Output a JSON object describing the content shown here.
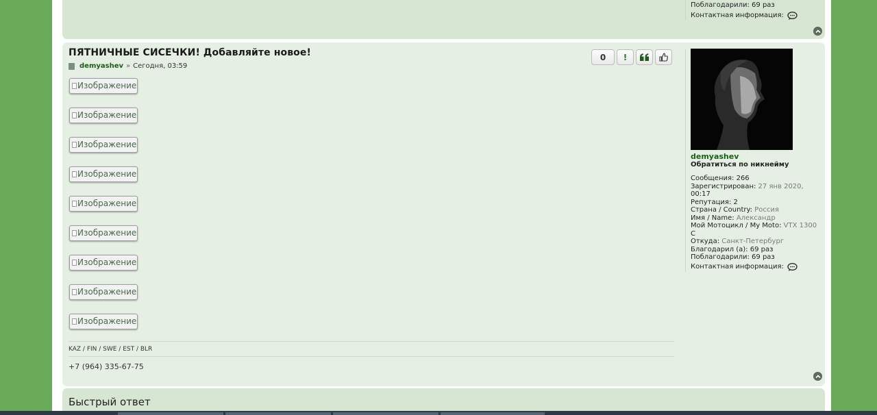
{
  "prev_post": {
    "thanked_label": "Поблагодарили:",
    "thanked_value": "69 раз",
    "contact_label": "Контактная информация:"
  },
  "post": {
    "title": "ПЯТНИЧНЫЕ СИСЕЧКИ! Добавляйте новое!",
    "author": "demyashev",
    "separator": "»",
    "date": "Сегодня, 03:59",
    "score": "0",
    "report_label": "!",
    "quote_icon": "quote-icon",
    "like_icon": "thumbs-up-icon",
    "images": [
      "Изображение",
      "Изображение",
      "Изображение",
      "Изображение",
      "Изображение",
      "Изображение",
      "Изображение",
      "Изображение",
      "Изображение"
    ],
    "signature_countries": "KAZ / FIN / SWE / EST / BLR",
    "signature_phone": "+7 (964) 335-67-75"
  },
  "profile": {
    "username": "demyashev",
    "mention": "Обратиться по никнейму",
    "posts_label": "Сообщения:",
    "posts_value": "266",
    "registered_label": "Зарегистрирован:",
    "registered_value": "27 янв 2020,",
    "registered_time": "00:17",
    "reputation_label": "Репутация:",
    "reputation_value": "2",
    "country_label": "Страна / Country:",
    "country_value": "Россия",
    "name_label": "Имя / Name:",
    "name_value": "Александр",
    "moto_label": "Мой Мотоцикл / My Moto:",
    "moto_value": "VTX 1300",
    "moto_value2": "C",
    "from_label": "Откуда:",
    "from_value": "Санкт-Петербург",
    "thanks_given_label": "Благодарил (а):",
    "thanks_given_value": "69 раз",
    "thanks_recv_label": "Поблагодарили:",
    "thanks_recv_value": "69 раз",
    "contact_label": "Контактная информация:"
  },
  "quick_reply": {
    "title": "Быстрый ответ"
  },
  "colors": {
    "background": "#6aab5a",
    "panel": "#d7e6d3",
    "link": "#1a5e17"
  }
}
